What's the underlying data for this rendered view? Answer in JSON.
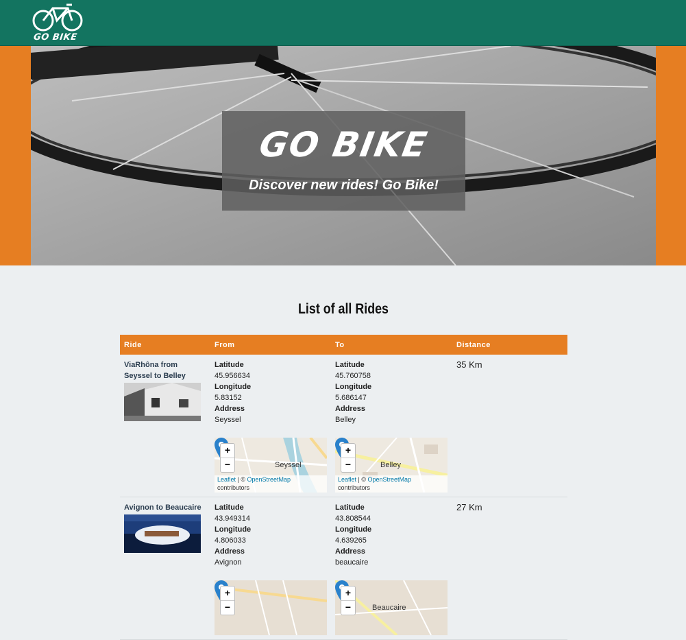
{
  "brand": {
    "logo_text": "GO BIKE"
  },
  "hero": {
    "title": "GO BIKE",
    "subtitle": "Discover new rides! Go Bike!"
  },
  "page": {
    "title": "List of all Rides"
  },
  "table": {
    "headers": [
      "Ride",
      "From",
      "To",
      "Distance"
    ],
    "field_labels": {
      "latitude": "Latitude",
      "longitude": "Longitude",
      "address": "Address"
    },
    "rows": [
      {
        "ride": "ViaRhôna from Seyssel to Belley",
        "from": {
          "latitude": "45.956634",
          "longitude": "5.83152",
          "address": "Seyssel",
          "map_label": "Seyssel"
        },
        "to": {
          "latitude": "45.760758",
          "longitude": "5.686147",
          "address": "Belley",
          "map_label": "Belley"
        },
        "distance": "35 Km"
      },
      {
        "ride": "Avignon to Beaucaire",
        "from": {
          "latitude": "43.949314",
          "longitude": "4.806033",
          "address": "Avignon",
          "map_label": ""
        },
        "to": {
          "latitude": "43.808544",
          "longitude": "4.639265",
          "address": "beaucaire",
          "map_label": "Beaucaire"
        },
        "distance": "27 Km"
      }
    ]
  },
  "map": {
    "zoom_in": "+",
    "zoom_out": "−",
    "attrib_leaflet": "Leaflet",
    "attrib_sep": " | © ",
    "attrib_osm": "OpenStreetMap",
    "attrib_contrib": "contributors"
  },
  "colors": {
    "header": "#137460",
    "accent": "#e67e22",
    "background": "#eceff1",
    "marker": "#2a81cb"
  }
}
